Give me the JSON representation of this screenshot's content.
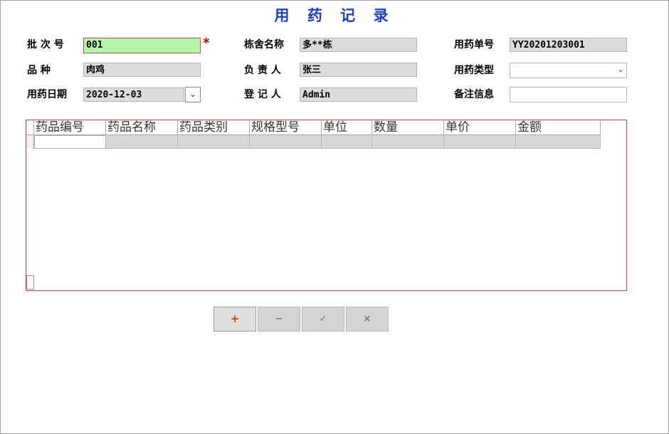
{
  "title": "用 药 记 录",
  "form": {
    "batch_label": "批 次 号",
    "batch_value": "001",
    "required_mark": "*",
    "variety_label": "品    种",
    "variety_value": "肉鸡",
    "date_label": "用药日期",
    "date_value": "2020-12-03",
    "barn_label": "栋舍名称",
    "barn_value": "多**栋",
    "owner_label": "负 责 人",
    "owner_value": "张三",
    "registrar_label": "登 记 人",
    "registrar_value": "Admin",
    "order_label": "用药单号",
    "order_value": "YY20201203001",
    "type_label": "用药类型",
    "type_value": "",
    "remark_label": "备注信息",
    "remark_value": ""
  },
  "grid": {
    "columns": [
      "药品编号",
      "药品名称",
      "药品类别",
      "规格型号",
      "单位",
      "数量",
      "单价",
      "金额"
    ]
  },
  "buttons": {
    "add": "+",
    "remove": "−",
    "confirm": "✓",
    "cancel": "×"
  },
  "colors": {
    "title": "#1a3fc9",
    "required": "#e00000",
    "active_field": "#b8f5a8",
    "grid_border": "#d43b3b",
    "add_icon": "#e03a00"
  },
  "icons": {
    "dropdown": "chevron-down-icon",
    "date_picker": "chevron-down-icon"
  }
}
